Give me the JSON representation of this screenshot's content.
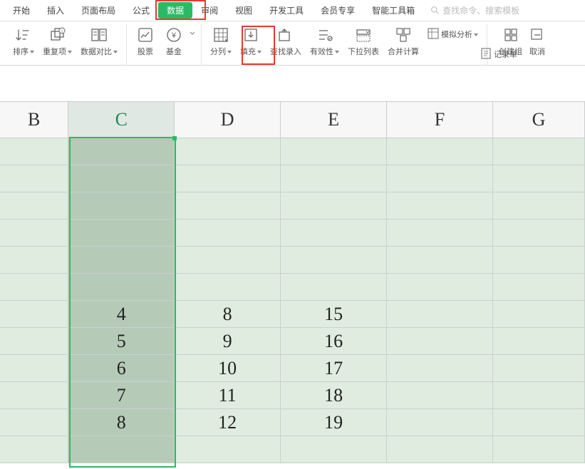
{
  "tabs": {
    "start": "开始",
    "insert": "插入",
    "layout": "页面布局",
    "formula": "公式",
    "data": "数据",
    "review": "审阅",
    "view": "视图",
    "dev": "开发工具",
    "member": "会员专享",
    "smart": "智能工具箱"
  },
  "search": {
    "placeholder": "查找命令、搜索模板"
  },
  "ribbon": {
    "sort": "排序",
    "dedup": "重复项",
    "compare": "数据对比",
    "stock": "股票",
    "fund": "基金",
    "split": "分列",
    "fill": "填充",
    "findInput": "查找录入",
    "validity": "有效性",
    "dropdown": "下拉列表",
    "consolidate": "合并计算",
    "whatif": "模拟分析",
    "form": "记录单",
    "group": "创建组",
    "cancel": "取消"
  },
  "columns": {
    "B": "B",
    "C": "C",
    "D": "D",
    "E": "E",
    "F": "F",
    "G": "G"
  },
  "chart_data": {
    "type": "table",
    "title": "",
    "columns": [
      "B",
      "C",
      "D",
      "E",
      "F",
      "G"
    ],
    "rows": [
      {
        "C": "",
        "D": "",
        "E": ""
      },
      {
        "C": "",
        "D": "",
        "E": ""
      },
      {
        "C": "",
        "D": "",
        "E": ""
      },
      {
        "C": "",
        "D": "",
        "E": ""
      },
      {
        "C": "",
        "D": "",
        "E": ""
      },
      {
        "C": "4",
        "D": "8",
        "E": "15"
      },
      {
        "C": "5",
        "D": "9",
        "E": "16"
      },
      {
        "C": "6",
        "D": "10",
        "E": "17"
      },
      {
        "C": "7",
        "D": "11",
        "E": "18"
      },
      {
        "C": "8",
        "D": "12",
        "E": "19"
      },
      {
        "C": "",
        "D": "",
        "E": ""
      },
      {
        "C": "",
        "D": "",
        "E": ""
      }
    ]
  },
  "cells": {
    "r5": {
      "C": "4",
      "D": "8",
      "E": "15"
    },
    "r6": {
      "C": "5",
      "D": "9",
      "E": "16"
    },
    "r7": {
      "C": "6",
      "D": "10",
      "E": "17"
    },
    "r8": {
      "C": "7",
      "D": "11",
      "E": "18"
    },
    "r9": {
      "C": "8",
      "D": "12",
      "E": "19"
    }
  }
}
